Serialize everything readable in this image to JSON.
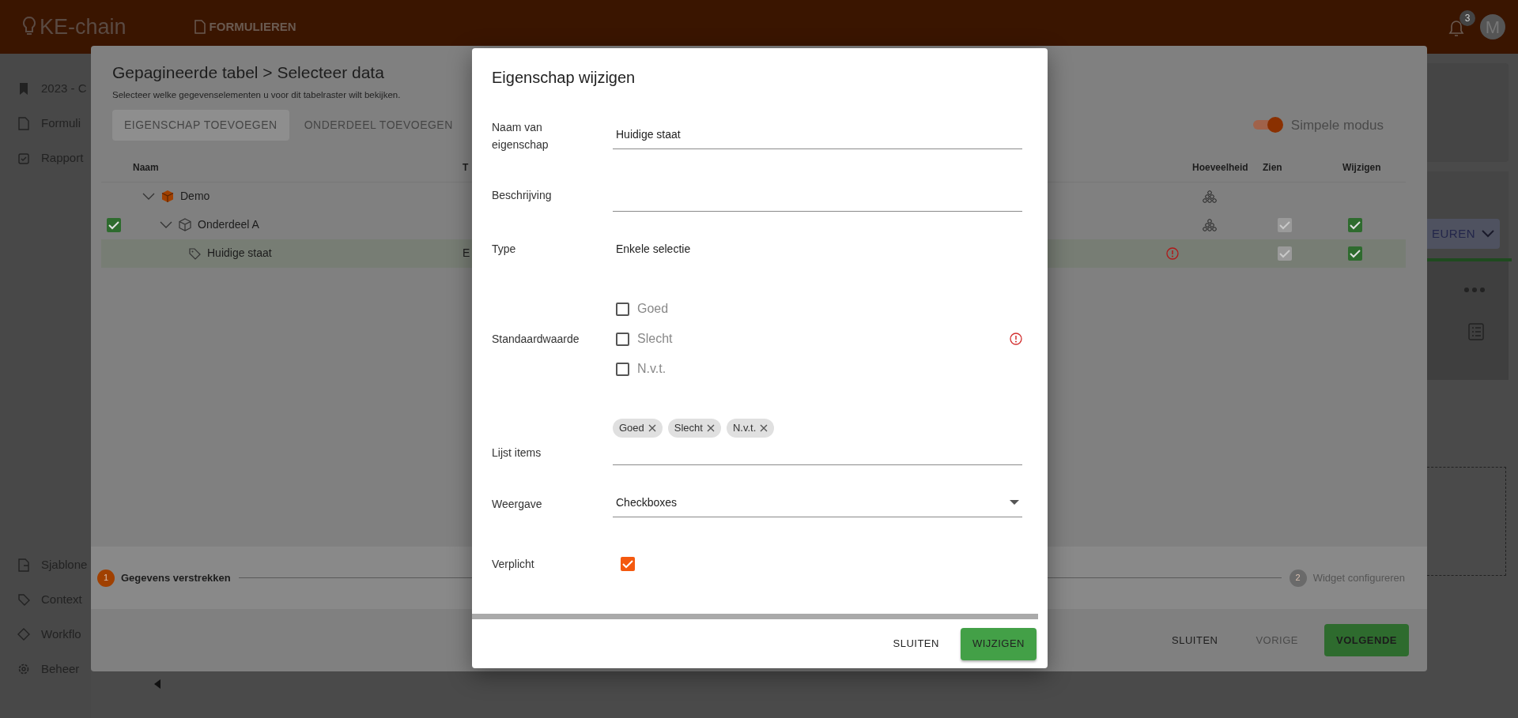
{
  "header": {
    "logo": "KE-chain",
    "nav_item": "FORMULIEREN",
    "notification_count": "3",
    "avatar_initial": "M"
  },
  "sidebar": {
    "items": [
      {
        "label": "2023 - C",
        "kind": "bookmark"
      },
      {
        "label": "Formuli",
        "kind": "document"
      },
      {
        "label": "Rapport",
        "kind": "report"
      }
    ],
    "bottom_items": [
      {
        "label": "Sjablone",
        "kind": "template"
      },
      {
        "label": "Context",
        "kind": "tag"
      },
      {
        "label": "Workflo",
        "kind": "workflow"
      },
      {
        "label": "Beheer",
        "kind": "gear"
      }
    ]
  },
  "background_panel": {
    "button_label": "EUREN"
  },
  "wizard": {
    "title": "Gepagineerde tabel > Selecteer data",
    "subtitle": "Selecteer welke gegevenselementen u voor dit tabelraster wilt bekijken.",
    "buttons": [
      {
        "label": "EIGENSCHAP TOEVOEGEN",
        "kind": "contained",
        "disabled": true
      },
      {
        "label": "ONDERDEEL TOEVOEGEN",
        "kind": "text",
        "disabled": true
      }
    ],
    "mode_switch": {
      "label": "Simpele modus",
      "on": true
    },
    "table": {
      "columns": [
        "Naam",
        "T",
        "Hoeveelheid",
        "Zien",
        "Wijzigen"
      ],
      "rows": [
        {
          "name": "Demo",
          "kind": "model",
          "expanded": true,
          "checked": false,
          "selected": false,
          "quantity": true,
          "warning": false,
          "children": [
            {
              "name": "Onderdeel A",
              "kind": "instance",
              "expanded": true,
              "checked": true,
              "selected": false,
              "quantity": true,
              "warning": false,
              "view_checked": true,
              "edit_checked": true,
              "children": [
                {
                  "name": "Huidige staat",
                  "kind": "property",
                  "type": "E",
                  "checked": false,
                  "selected": true,
                  "quantity": false,
                  "warning": true,
                  "view_checked": true,
                  "edit_checked": true
                }
              ]
            }
          ]
        }
      ]
    },
    "steps": [
      {
        "number": "1",
        "label": "Gegevens verstrekken",
        "selected": true
      },
      {
        "number": "2",
        "label": "Widget configureren",
        "selected": false
      }
    ],
    "footer_buttons": [
      {
        "label": "SLUITEN",
        "kind": "text"
      },
      {
        "label": "VORIGE",
        "kind": "disabled"
      },
      {
        "label": "VOLGENDE",
        "kind": "primary"
      }
    ]
  },
  "dialog": {
    "title": "Eigenschap wijzigen",
    "fields": [
      {
        "kind": "text",
        "label": "Naam van eigenschap",
        "value": "Huidige staat"
      },
      {
        "kind": "text",
        "label": "Beschrijving"
      },
      {
        "kind": "static",
        "label": "Type",
        "value": "Enkele selectie"
      },
      {
        "kind": "checkbox_group",
        "label": "Standaardwaarde",
        "error": true,
        "options": [
          {
            "label": "Goed",
            "checked": false
          },
          {
            "label": "Slecht",
            "checked": false
          },
          {
            "label": "N.v.t.",
            "checked": false
          }
        ]
      },
      {
        "kind": "chips",
        "label": "Lijst items",
        "chips": [
          "Goed",
          "Slecht",
          "N.v.t."
        ]
      },
      {
        "kind": "select",
        "label": "Weergave",
        "value": "Checkboxes"
      },
      {
        "kind": "checkbox",
        "label": "Verplicht",
        "checked": true
      }
    ],
    "buttons": [
      {
        "label": "SLUITEN",
        "kind": "text"
      },
      {
        "label": "WIJZIGEN",
        "kind": "primary"
      }
    ]
  }
}
